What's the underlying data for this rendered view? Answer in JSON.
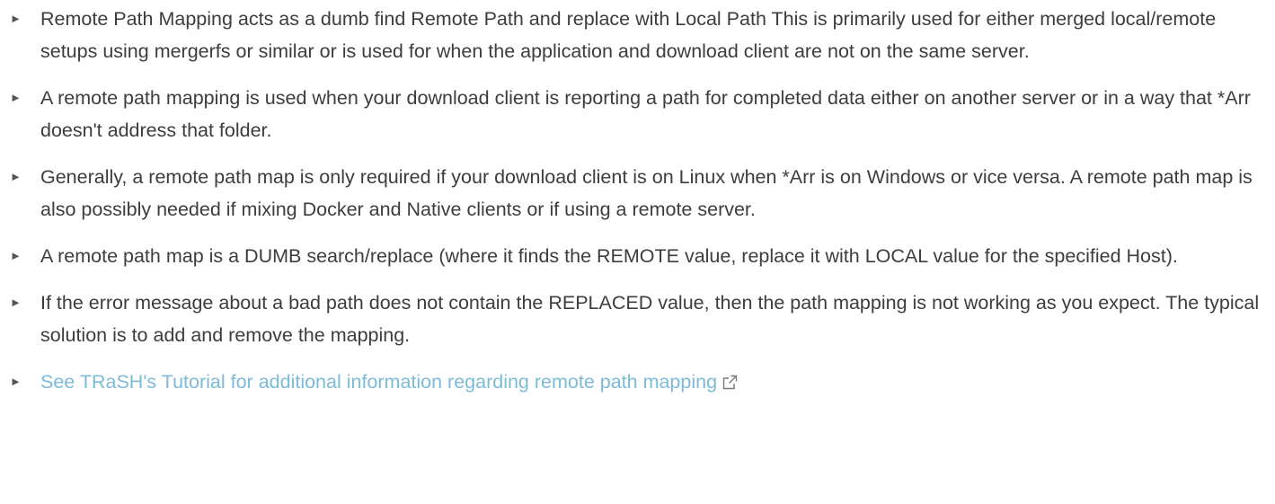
{
  "items": [
    {
      "text": "Remote Path Mapping acts as a dumb find Remote Path and replace with Local Path This is primarily used for either merged local/remote setups using mergerfs or similar or is used for when the application and download client are not on the same server."
    },
    {
      "text": "A remote path mapping is used when your download client is reporting a path for completed data either on another server or in a way that *Arr doesn't address that folder."
    },
    {
      "text": "Generally, a remote path map is only required if your download client is on Linux when *Arr is on Windows or vice versa. A remote path map is also possibly needed if mixing Docker and Native clients or if using a remote server."
    },
    {
      "text": "A remote path map is a DUMB search/replace (where it finds the REMOTE value, replace it with LOCAL value for the specified Host)."
    },
    {
      "text": "If the error message about a bad path does not contain the REPLACED value, then the path mapping is not working as you expect. The typical solution is to add and remove the mapping."
    }
  ],
  "link_item": {
    "text": "See TRaSH's Tutorial for additional information regarding remote path mapping",
    "icon": "external-link-icon"
  },
  "bullet_glyph": "►",
  "colors": {
    "text": "#3d3d3d",
    "link": "#7cbbd9",
    "bullet": "#555555"
  }
}
